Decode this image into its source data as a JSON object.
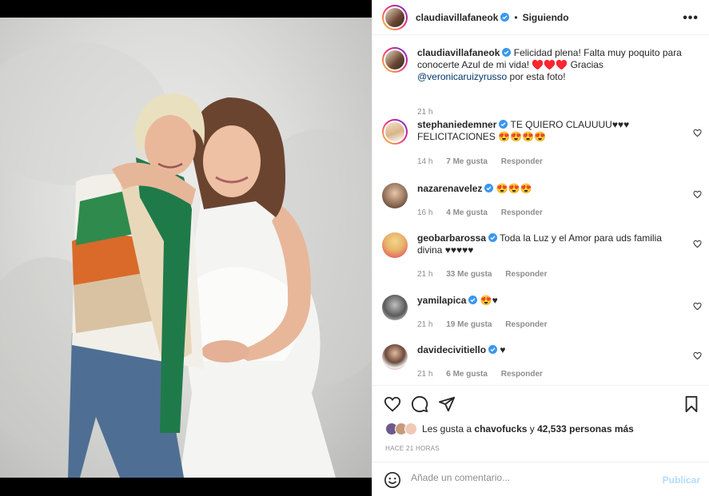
{
  "post": {
    "author": "claudiavillafaneok",
    "follow_status": "Siguiendo",
    "dot": "•",
    "more_label": "•••"
  },
  "caption": {
    "author": "claudiavillafaneok",
    "text_before": "Felicidad plena! Falta muy poquito para conocerte Azul de mi vida! ♥️♥️♥️ Gracias ",
    "mention": "@veronicaruizyrusso",
    "text_after": " por esta foto!",
    "time": "21 h"
  },
  "comments": [
    {
      "user": "stephaniedemner",
      "text": "TE QUIERO CLAUUUU♥♥♥ FELICITACIONES 😍😍😍😍",
      "time": "14 h",
      "likes": "7 Me gusta",
      "reply": "Responder"
    },
    {
      "user": "nazarenavelez",
      "text": "😍😍😍",
      "time": "16 h",
      "likes": "4 Me gusta",
      "reply": "Responder"
    },
    {
      "user": "geobarbarossa",
      "text": "Toda la Luz y el Amor para uds familia divina ♥♥♥♥♥",
      "time": "21 h",
      "likes": "33 Me gusta",
      "reply": "Responder"
    },
    {
      "user": "yamilapica",
      "text": "😍♥",
      "time": "21 h",
      "likes": "19 Me gusta",
      "reply": "Responder"
    },
    {
      "user": "davidecivitiello",
      "text": "♥",
      "time": "21 h",
      "likes": "6 Me gusta",
      "reply": "Responder"
    }
  ],
  "likes_summary": {
    "prefix": "Les gusta a ",
    "user": "chavofucks",
    "middle": " y ",
    "count": "42,533 personas más"
  },
  "posted_ago": "HACE 21 HORAS",
  "add_comment": {
    "placeholder": "Añade un comentario...",
    "publish_label": "Publicar"
  },
  "icons": {
    "like": "heart-icon",
    "comment": "comment-icon",
    "share": "paper-plane-icon",
    "save": "bookmark-icon",
    "emoji": "emoji-icon",
    "verified": "verified-badge-icon"
  },
  "colors": {
    "verified": "#3897f0",
    "link": "#00376b",
    "muted": "#8e8e8e",
    "publish_disabled": "#b3dbff"
  }
}
